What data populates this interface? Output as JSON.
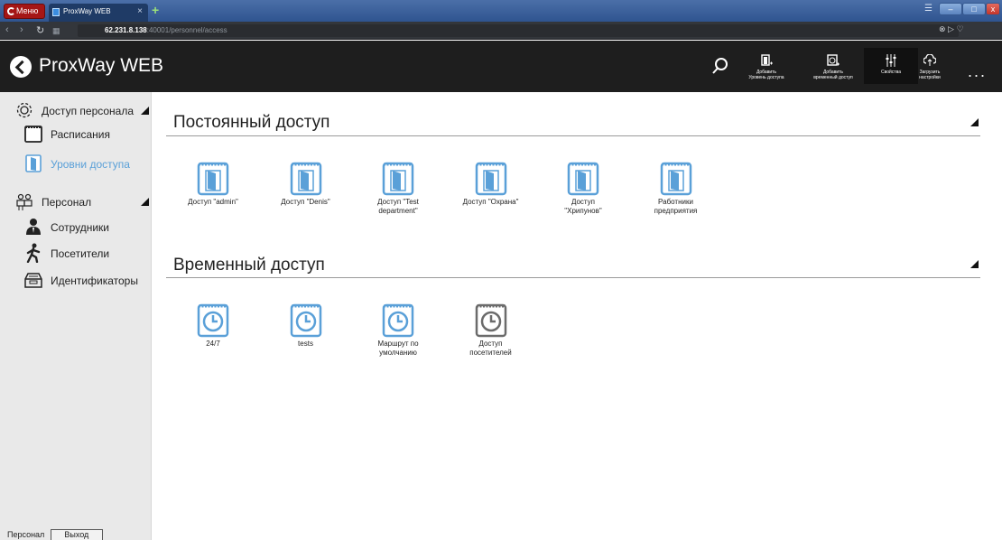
{
  "browser": {
    "menu_label": "Меню",
    "tab_title": "ProxWay WEB",
    "tab_close": "×",
    "new_tab": "+",
    "url_host": "62.231.8.138",
    "url_path": ":40001/personnel/access",
    "window_min": "–",
    "window_max": "□",
    "window_close": "x"
  },
  "header": {
    "app_title": "ProxWay WEB",
    "tools": [
      {
        "label_1": "Добавить",
        "label_2": "Уровень доступа",
        "icon": "add-door-icon"
      },
      {
        "label_1": "Добавить",
        "label_2": "временный доступ",
        "icon": "add-schedule-icon"
      },
      {
        "label_1": "Свойства",
        "label_2": "",
        "icon": "sliders-icon"
      },
      {
        "label_1": "Загрузить",
        "label_2": "настройки",
        "icon": "cloud-upload-icon"
      }
    ],
    "more": "..."
  },
  "sidebar": {
    "groups": [
      {
        "label": "Доступ персонала",
        "icon": "gear-icon"
      },
      {
        "label": "Персонал",
        "icon": "people-icon"
      }
    ],
    "items": [
      {
        "label": "Расписания",
        "icon": "calendar-icon"
      },
      {
        "label": "Уровни доступа",
        "icon": "door-icon",
        "active": true
      },
      {
        "label": "Сотрудники",
        "icon": "employee-icon"
      },
      {
        "label": "Посетители",
        "icon": "walker-icon"
      },
      {
        "label": "Идентификаторы",
        "icon": "card-box-icon"
      }
    ],
    "footer_label": "Персонал",
    "footer_button": "Выход"
  },
  "main": {
    "permanent": {
      "title": "Постоянный доступ",
      "tiles": [
        {
          "line1": "Доступ \"admin\"",
          "line2": ""
        },
        {
          "line1": "Доступ \"Denis\"",
          "line2": ""
        },
        {
          "line1": "Доступ \"Test",
          "line2": "department\""
        },
        {
          "line1": "Доступ \"Охрана\"",
          "line2": ""
        },
        {
          "line1": "Доступ",
          "line2": "\"Хрипунов\""
        },
        {
          "line1": "Работники",
          "line2": "предприятия"
        }
      ]
    },
    "temporary": {
      "title": "Временный доступ",
      "tiles": [
        {
          "line1": "24/7",
          "line2": ""
        },
        {
          "line1": "tests",
          "line2": ""
        },
        {
          "line1": "Маршрут по",
          "line2": "умолчанию"
        },
        {
          "line1": "Доступ",
          "line2": "посетителей"
        }
      ]
    }
  },
  "colors": {
    "accent": "#5aa0d8",
    "header_bg": "#1e1e1e",
    "sidebar_bg": "#e9e9e9",
    "visitor_tile": "#6b6b6b"
  }
}
